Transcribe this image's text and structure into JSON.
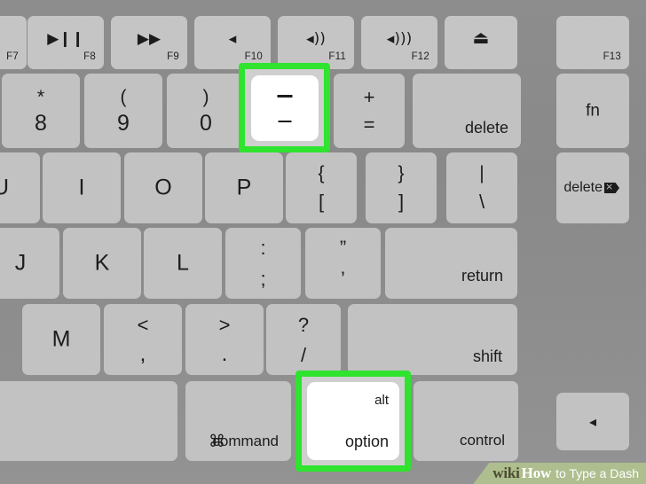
{
  "image": {
    "subject": "apple-keyboard-closeup",
    "highlight_color": "#2fe32f",
    "key_color": "#c2c2c2",
    "background_color": "#8c8c8c",
    "highlighted_keys": [
      "minus-key",
      "option-key"
    ]
  },
  "watermark": {
    "wiki": "wiki",
    "how": "How",
    "rest": "to Type a Dash",
    "background_color": "#aebe8e"
  },
  "function_row": [
    {
      "name": "f7",
      "glyph": "",
      "fnum": "F7"
    },
    {
      "name": "f8",
      "glyph": "▶❙❙",
      "fnum": "F8"
    },
    {
      "name": "f9",
      "glyph": "▶▶",
      "fnum": "F9"
    },
    {
      "name": "f10",
      "glyph": "◂",
      "fnum": "F10"
    },
    {
      "name": "f11",
      "glyph": "◂))",
      "fnum": "F11"
    },
    {
      "name": "f12",
      "glyph": "◂)))",
      "fnum": "F12"
    },
    {
      "name": "eject",
      "glyph": "⏏",
      "fnum": ""
    },
    {
      "name": "f13",
      "glyph": "",
      "fnum": "F13"
    }
  ],
  "number_row": [
    {
      "name": "eight-key",
      "upper": "*",
      "lower": "8"
    },
    {
      "name": "nine-key",
      "upper": "(",
      "lower": "9"
    },
    {
      "name": "zero-key",
      "upper": ")",
      "lower": "0"
    },
    {
      "name": "minus-key",
      "upper": "—",
      "lower": "–",
      "highlighted": true
    },
    {
      "name": "equals-key",
      "upper": "+",
      "lower": "="
    },
    {
      "name": "delete-key",
      "label": "delete"
    },
    {
      "name": "fn-key",
      "label": "fn"
    }
  ],
  "letter_row_top": [
    {
      "name": "u-key",
      "label": "U"
    },
    {
      "name": "i-key",
      "label": "I"
    },
    {
      "name": "o-key",
      "label": "O"
    },
    {
      "name": "p-key",
      "label": "P"
    },
    {
      "name": "left-bracket-key",
      "upper": "{",
      "lower": "["
    },
    {
      "name": "right-bracket-key",
      "upper": "}",
      "lower": "]"
    },
    {
      "name": "backslash-key",
      "upper": "|",
      "lower": "\\"
    },
    {
      "name": "forward-delete-key",
      "label": "delete"
    }
  ],
  "letter_row_home": [
    {
      "name": "j-key",
      "label": "J"
    },
    {
      "name": "k-key",
      "label": "K"
    },
    {
      "name": "l-key",
      "label": "L"
    },
    {
      "name": "semicolon-key",
      "upper": ":",
      "lower": ";"
    },
    {
      "name": "quote-key",
      "upper": "”",
      "lower": "’"
    },
    {
      "name": "return-key",
      "label": "return"
    }
  ],
  "letter_row_bottom": [
    {
      "name": "m-key",
      "label": "M"
    },
    {
      "name": "comma-key",
      "upper": "<",
      "lower": ","
    },
    {
      "name": "period-key",
      "upper": ">",
      "lower": "."
    },
    {
      "name": "slash-key",
      "upper": "?",
      "lower": "/"
    },
    {
      "name": "shift-key",
      "label": "shift"
    }
  ],
  "modifier_row": [
    {
      "name": "spacebar",
      "label": ""
    },
    {
      "name": "command-key",
      "glyph": "⌘",
      "label": "command"
    },
    {
      "name": "option-key",
      "upper": "alt",
      "lower": "option",
      "highlighted": true
    },
    {
      "name": "control-key",
      "label": "control"
    },
    {
      "name": "left-arrow-key",
      "label": "◂"
    }
  ]
}
